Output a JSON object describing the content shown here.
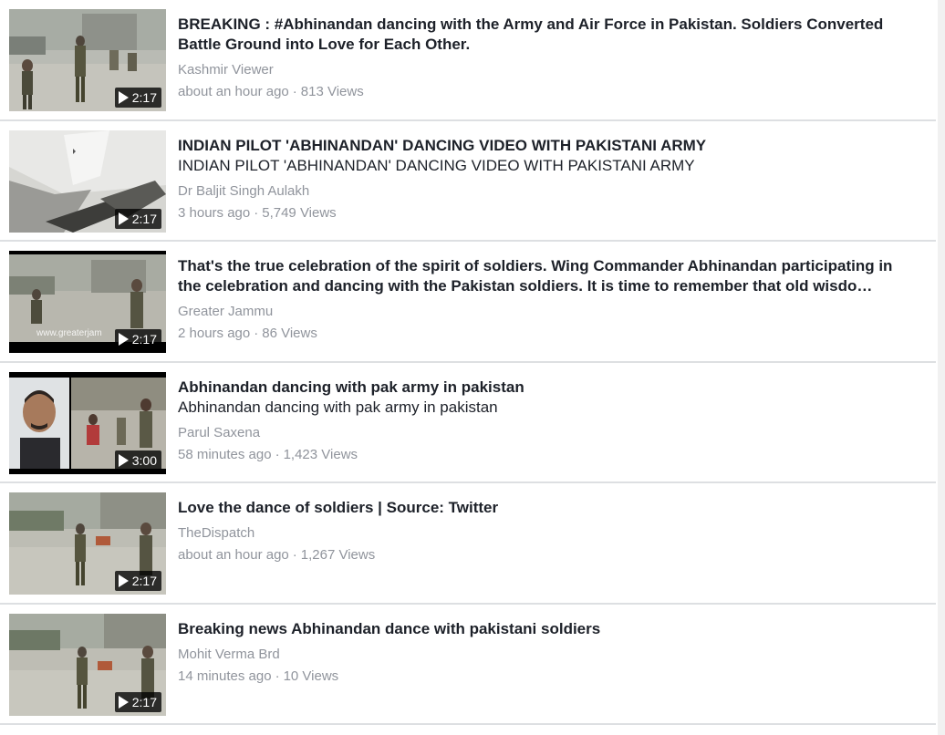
{
  "videos": [
    {
      "title": "BREAKING : #Abhinandan dancing with the Army and Air Force in Pakistan. Soldiers Converted Battle Ground into Love for Each Other.",
      "subtitle": "",
      "channel": "Kashmir Viewer",
      "time": "about an hour ago",
      "separator": "·",
      "views": "813 Views",
      "duration": "2:17"
    },
    {
      "title": "INDIAN PILOT 'ABHINANDAN' DANCING VIDEO WITH PAKISTANI ARMY",
      "subtitle": "INDIAN PILOT 'ABHINANDAN' DANCING VIDEO WITH PAKISTANI ARMY",
      "channel": "Dr Baljit Singh Aulakh",
      "time": "3 hours ago",
      "separator": "·",
      "views": "5,749 Views",
      "duration": "2:17"
    },
    {
      "title": "That's the true celebration of the spirit of soldiers. Wing Commander Abhinandan participating in the celebration and dancing with the Pakistan soldiers. It is time to remember that old wisdo…",
      "subtitle": "",
      "channel": "Greater Jammu",
      "time": "2 hours ago",
      "separator": "·",
      "views": "86 Views",
      "duration": "2:17",
      "watermark": "www.greaterjam"
    },
    {
      "title": "Abhinandan dancing with pak army in pakistan",
      "subtitle": "Abhinandan dancing with pak army in pakistan",
      "channel": "Parul Saxena",
      "time": "58 minutes ago",
      "separator": "·",
      "views": "1,423 Views",
      "duration": "3:00"
    },
    {
      "title": "Love the dance of soldiers | Source: Twitter",
      "subtitle": "",
      "channel": "TheDispatch",
      "time": "about an hour ago",
      "separator": "·",
      "views": "1,267 Views",
      "duration": "2:17"
    },
    {
      "title": "Breaking news Abhinandan dance with pakistani soldiers",
      "subtitle": "",
      "channel": "Mohit Verma Brd",
      "time": "14 minutes ago",
      "separator": "·",
      "views": "10 Views",
      "duration": "2:17"
    }
  ]
}
